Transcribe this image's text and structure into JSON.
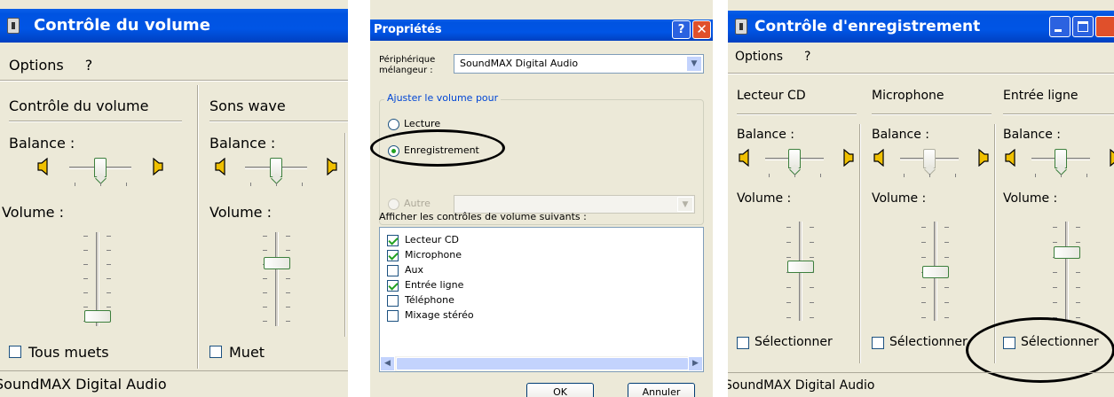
{
  "volume_window": {
    "title": "Contrôle du volume",
    "menu": [
      "Options",
      "?"
    ],
    "columns": [
      {
        "name": "Contrôle du volume",
        "balance_label": "Balance :",
        "volume_label": "Volume :",
        "balance_level": 0.5,
        "volume_level": 0.0,
        "checkbox_label": "Tous muets",
        "checked": false
      },
      {
        "name": "Sons wave",
        "balance_label": "Balance :",
        "volume_label": "Volume :",
        "balance_level": 0.5,
        "volume_level": 0.55,
        "checkbox_label": "Muet",
        "checked": false
      }
    ],
    "status": "SoundMAX Digital Audio"
  },
  "properties_dialog": {
    "title": "Propriétés",
    "mixer_label": "Périphérique mélangeur :",
    "mixer_value": "SoundMAX Digital Audio",
    "group_label": "Ajuster le volume pour",
    "radios": [
      {
        "label": "Lecture",
        "selected": false
      },
      {
        "label": "Enregistrement",
        "selected": true
      },
      {
        "label": "Autre",
        "selected": false,
        "disabled": true
      }
    ],
    "controls_label": "Afficher les contrôles de volume suivants :",
    "controls": [
      {
        "label": "Lecteur CD",
        "checked": true
      },
      {
        "label": "Microphone",
        "checked": true
      },
      {
        "label": "Aux",
        "checked": false
      },
      {
        "label": "Entrée ligne",
        "checked": true
      },
      {
        "label": "Téléphone",
        "checked": false
      },
      {
        "label": "Mixage stéréo",
        "checked": false
      }
    ],
    "ok_label": "OK",
    "cancel_label": "Annuler"
  },
  "recording_window": {
    "title": "Contrôle d'enregistrement",
    "menu": [
      "Options",
      "?"
    ],
    "columns": [
      {
        "name": "Lecteur CD",
        "balance_label": "Balance :",
        "volume_label": "Volume :",
        "balance_level": 0.5,
        "volume_level": 0.55,
        "checkbox_label": "Sélectionner",
        "checked": false,
        "balance_disabled": false
      },
      {
        "name": "Microphone",
        "balance_label": "Balance :",
        "volume_label": "Volume :",
        "balance_level": 0.5,
        "volume_level": 0.5,
        "checkbox_label": "Sélectionner",
        "checked": false,
        "balance_disabled": true
      },
      {
        "name": "Entrée ligne",
        "balance_label": "Balance :",
        "volume_label": "Volume :",
        "balance_level": 0.5,
        "volume_level": 0.7,
        "checkbox_label": "Sélectionner",
        "checked": false,
        "balance_disabled": false
      }
    ],
    "status": "SoundMAX Digital Audio"
  },
  "colors": {
    "titlebar": "#0055e5",
    "window_bg": "#ece9d8",
    "close_button": "#e0502b",
    "highlight_circle": "#000000"
  }
}
